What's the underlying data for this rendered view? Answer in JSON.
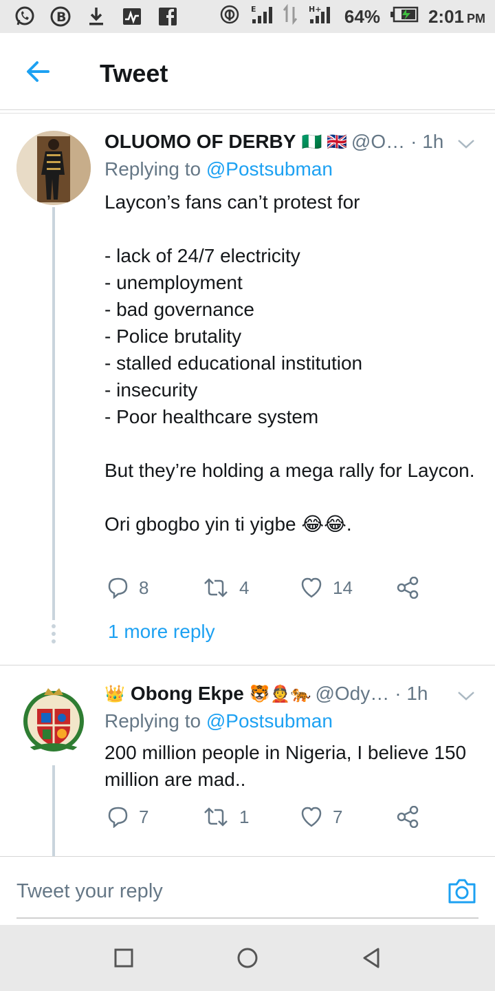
{
  "status_bar": {
    "battery_percent": "64%",
    "time": "2:01",
    "ampm": "PM",
    "left_icons": [
      "whatsapp-icon",
      "b-icon",
      "download-icon",
      "activity-icon",
      "facebook-icon"
    ],
    "right_icons": [
      "hotspot-icon",
      "signal-e-icon",
      "data-arrows-icon",
      "signal-h-icon",
      "battery-icon"
    ]
  },
  "header": {
    "title": "Tweet"
  },
  "tweets": [
    {
      "name": "OLUOMO OF DERBY",
      "flags": "🇳🇬 🇬🇧",
      "handle": "@O…",
      "time": "· 1h",
      "replying_prefix": "Replying to ",
      "replying_to": "@Postsubman",
      "body": "Laycon’s fans can’t protest for\n\n- lack of 24/7 electricity\n- unemployment\n- bad governance\n- Police brutality\n- stalled educational institution\n- insecurity\n- Poor healthcare system\n\nBut they’re holding a mega rally for Laycon.\n\nOri gbogbo yin ti yigbe 😂😂.",
      "replies": "8",
      "retweets": "4",
      "likes": "14",
      "more_replies": "1 more reply"
    },
    {
      "name_prefix": "👑",
      "name": "Obong Ekpe",
      "name_suffix": "🐯👲🐅",
      "handle": "@Ody…",
      "time": "· 1h",
      "replying_prefix": "Replying to ",
      "replying_to": "@Postsubman",
      "body": "200 million people in Nigeria, I believe 150 million are mad..",
      "replies": "7",
      "retweets": "1",
      "likes": "7"
    }
  ],
  "reply_bar": {
    "placeholder": "Tweet your reply"
  },
  "colors": {
    "accent": "#1da1f2",
    "secondary_text": "#657786",
    "primary_text": "#14171a"
  }
}
